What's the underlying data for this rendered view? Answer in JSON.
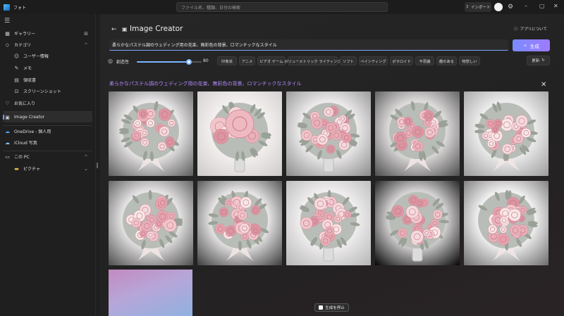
{
  "titlebar": {
    "app_title": "フォト",
    "search_placeholder": "ファイル名、種類、日付の検索",
    "import_label": "インポート"
  },
  "sidebar": {
    "gallery": "ギャラリー",
    "categories": "カテゴリ",
    "user_info": "ユーザー情報",
    "memo": "メモ",
    "receipt": "領収書",
    "screenshot": "スクリーンショット",
    "favorites": "お気に入り",
    "image_creator": "Image Creator",
    "onedrive": "OneDrive - 個人用",
    "icloud": "iCloud 写真",
    "this_pc": "この PC",
    "pictures": "ピクチャ"
  },
  "main": {
    "page_title": "Image Creator",
    "about": "アプリについて",
    "prompt": "柔らかなパステル調のウェディング用の花束、無彩色の背景、ロマンチックなスタイル",
    "generate": "生成",
    "creativity_label": "創造性",
    "creativity_value": "80",
    "creativity_fraction": 0.8,
    "styles": [
      "印象派",
      "アニメ",
      "ビデオ ゲーム",
      "ボリューメトリック ライティング",
      "ソフト",
      "ペインティング",
      "ポラロイド",
      "不思議",
      "趣のある",
      "物悲しい"
    ],
    "refresh": "更新",
    "results_title": "柔らかなパステル調のウェディング用の花束、無彩色の背景、ロマンチックなスタイル",
    "stop_generation": "生成を停止"
  },
  "colors": {
    "accent": "#7ab4ff",
    "results_title": "#b28cff",
    "generate_gradient_start": "#7a8cff",
    "generate_gradient_end": "#9d7bff"
  },
  "tiles": [
    {
      "bg": "#e8e6e6",
      "vignette": "#5a5a5a",
      "vase": false,
      "big_rose": false
    },
    {
      "bg": "#f2efee",
      "vignette": "#cfcaca",
      "vase": true,
      "big_rose": true
    },
    {
      "bg": "#ebe9e9",
      "vignette": "#8a8a8a",
      "vase": true,
      "big_rose": false
    },
    {
      "bg": "#dddada",
      "vignette": "#4a4a4a",
      "vase": false,
      "big_rose": false
    },
    {
      "bg": "#ecebeb",
      "vignette": "#9a9a9a",
      "vase": false,
      "big_rose": false
    },
    {
      "bg": "#e4e2e2",
      "vignette": "#4a4a4a",
      "vase": false,
      "big_rose": false
    },
    {
      "bg": "#e6e4e4",
      "vignette": "#3a3a3a",
      "vase": false,
      "big_rose": false
    },
    {
      "bg": "#efeded",
      "vignette": "#b5b5b5",
      "vase": true,
      "big_rose": false
    },
    {
      "bg": "#d4d2d2",
      "vignette": "#000000",
      "vase": true,
      "big_rose": false
    },
    {
      "bg": "#f0efef",
      "vignette": "#6a6a6a",
      "vase": false,
      "big_rose": false
    }
  ]
}
